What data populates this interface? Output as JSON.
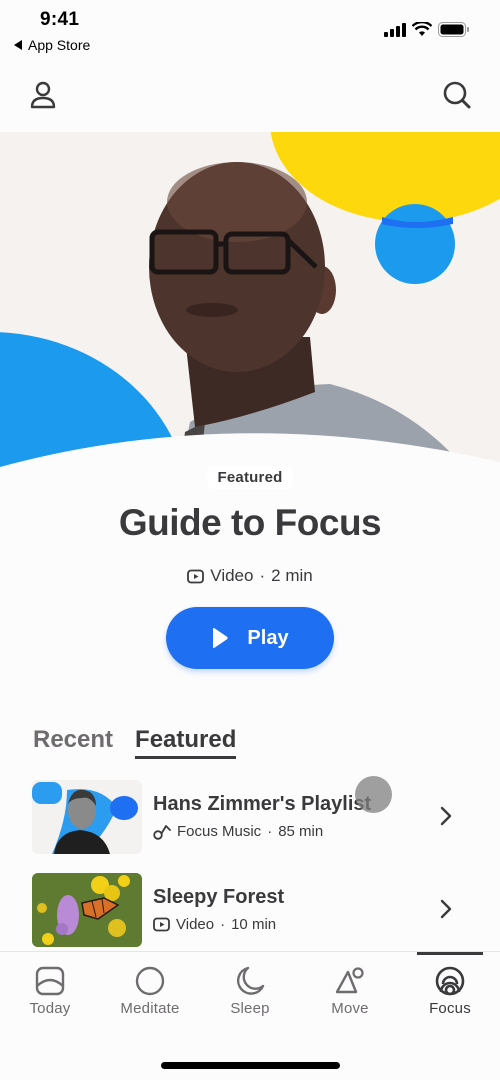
{
  "status_bar": {
    "time": "9:41",
    "back_label": "App Store"
  },
  "header": {
    "profile_icon": "person-icon",
    "search_icon": "search-icon"
  },
  "hero": {
    "colors": {
      "background": "#f5f2ef",
      "yellow": "#fcd80c",
      "blue": "#1b9aee",
      "dark_blue": "#1e6ff1"
    }
  },
  "feature": {
    "badge": "Featured",
    "title": "Guide to Focus",
    "type": "Video",
    "separator": "·",
    "duration": "2 min",
    "play_label": "Play",
    "play_color": "#1e6ff1"
  },
  "tabs": [
    {
      "label": "Recent",
      "active": false
    },
    {
      "label": "Featured",
      "active": true
    }
  ],
  "list": [
    {
      "title": "Hans Zimmer's Playlist",
      "icon": "music-note-icon",
      "category": "Focus Music",
      "duration": "85 min"
    },
    {
      "title": "Sleepy Forest",
      "icon": "video-icon",
      "category": "Video",
      "duration": "10 min"
    }
  ],
  "tabbar": [
    {
      "label": "Today",
      "icon": "today-icon",
      "active": false
    },
    {
      "label": "Meditate",
      "icon": "circle-icon",
      "active": false
    },
    {
      "label": "Sleep",
      "icon": "moon-icon",
      "active": false
    },
    {
      "label": "Move",
      "icon": "move-icon",
      "active": false
    },
    {
      "label": "Focus",
      "icon": "focus-icon",
      "active": true
    }
  ]
}
